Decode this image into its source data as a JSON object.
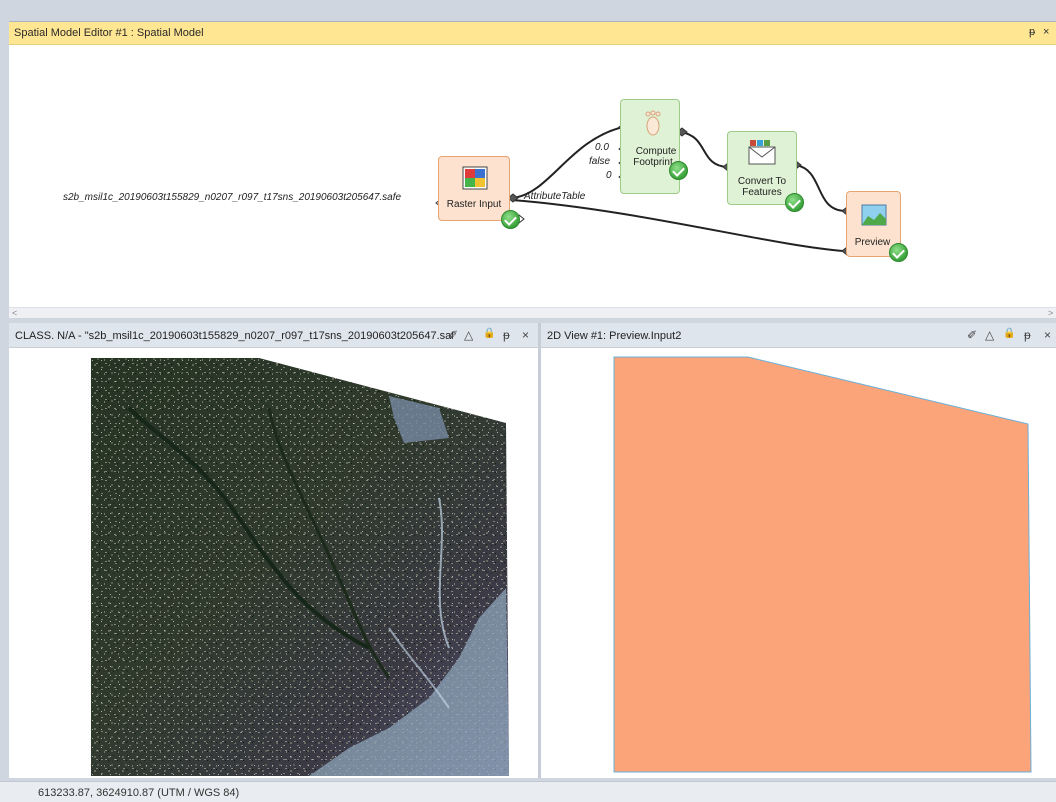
{
  "editor": {
    "title": "Spatial Model Editor #1 : Spatial Model",
    "pin": "ᵽ",
    "close": "×",
    "scroll_left": "<",
    "scroll_right": ">"
  },
  "model": {
    "input_label": "s2b_msil1c_20190603t155829_n0207_r097_t17sns_20190603t205647.safe",
    "raster_node": "Raster Input",
    "attribute_table": "AttributeTable",
    "footprint_ports": [
      "0.0",
      "false",
      "0"
    ],
    "compute_node": [
      "Compute",
      "Footprint"
    ],
    "convert_node": [
      "Convert To",
      "Features"
    ],
    "preview_node": "Preview"
  },
  "left_panel": {
    "title": "CLASS. N/A - \"s2b_msil1c_20190603t155829_n0207_r097_t17sns_20190603t205647.saf...",
    "icons": [
      "✐",
      "△",
      "🔒",
      "ᵽ",
      "×"
    ]
  },
  "right_panel": {
    "title": "2D View #1: Preview.Input2",
    "icons": [
      "✐",
      "△",
      "🔒",
      "ᵽ",
      "×"
    ],
    "polygon_fill": "#fba47a",
    "polygon_stroke": "#6ab0d8"
  },
  "status": {
    "coords": "613233.87, 3624910.87  (UTM / WGS 84)"
  },
  "colors": {
    "title_bar": "#ffe692",
    "node_orange": "#fde3cf",
    "node_green": "#dff2d5"
  }
}
